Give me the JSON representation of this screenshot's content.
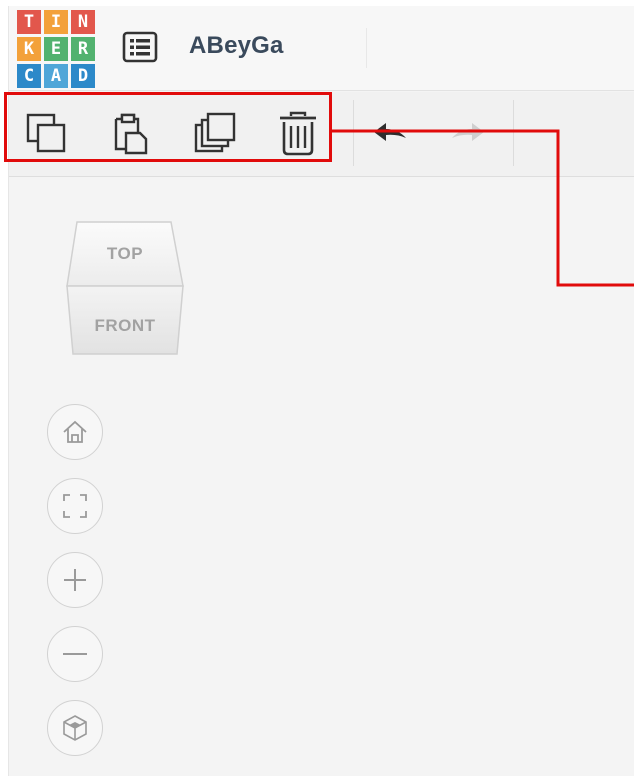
{
  "logo": {
    "letters": [
      [
        "T",
        "I",
        "N"
      ],
      [
        "K",
        "E",
        "R"
      ],
      [
        "C",
        "A",
        "D"
      ]
    ]
  },
  "header": {
    "menu_icon": "list-icon",
    "title": "ABeyGa"
  },
  "toolbar": {
    "tools": [
      {
        "name": "copy",
        "icon": "copy-icon"
      },
      {
        "name": "paste",
        "icon": "paste-icon"
      },
      {
        "name": "duplicate",
        "icon": "duplicate-icon"
      },
      {
        "name": "delete",
        "icon": "trash-icon"
      },
      {
        "name": "undo",
        "icon": "undo-icon"
      },
      {
        "name": "redo",
        "icon": "redo-icon"
      }
    ]
  },
  "viewcube": {
    "top": "TOP",
    "front": "FRONT"
  },
  "view_controls": [
    {
      "name": "home-view",
      "icon": "home-icon"
    },
    {
      "name": "fit-view",
      "icon": "fit-all-icon"
    },
    {
      "name": "zoom-in",
      "icon": "plus-icon"
    },
    {
      "name": "zoom-out",
      "icon": "minus-icon"
    },
    {
      "name": "perspective",
      "icon": "cube-perspective-icon"
    }
  ],
  "colors": {
    "highlight": "#e10b0b",
    "title": "#3a4a5c",
    "logo_red": "#e2574c",
    "logo_orange": "#f3a13a",
    "logo_green": "#52b26f",
    "logo_blue": "#2c89c9"
  }
}
